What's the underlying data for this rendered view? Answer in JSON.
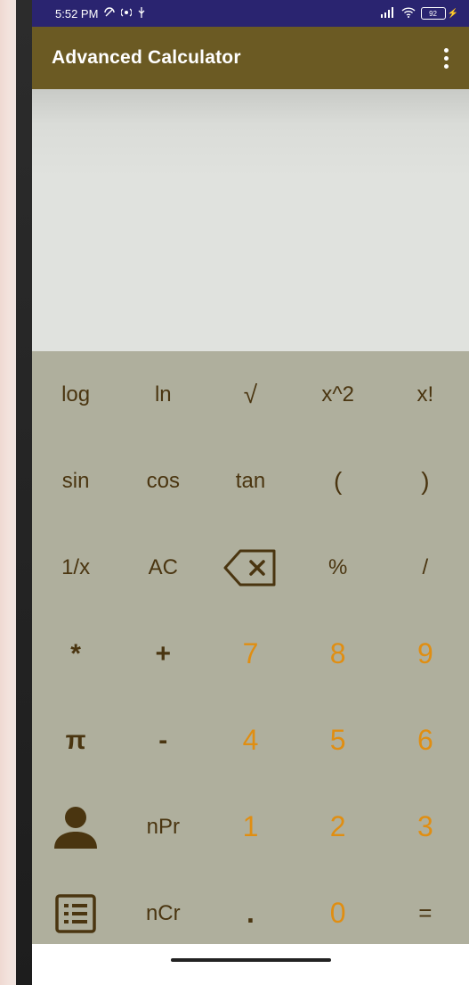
{
  "status": {
    "time": "5:52 PM",
    "left_icons": [
      "do-not-disturb-icon",
      "hotspot-icon",
      "usb-icon"
    ],
    "right_icons": [
      "signal-icon",
      "wifi-icon",
      "battery-icon"
    ],
    "battery": "92"
  },
  "appbar": {
    "title": "Advanced Calculator",
    "menu_icon": "more-vert-icon"
  },
  "colors": {
    "status_bar": "#2a2470",
    "app_bar": "#6b5a23",
    "keypad_bg": "#afaf9d",
    "display_bg": "#e0e2de",
    "digit_color": "#e08e12",
    "function_color": "#4a3510"
  },
  "keys": {
    "r1": [
      "log",
      "ln",
      "√",
      "x^2",
      "x!"
    ],
    "r2": [
      "sin",
      "cos",
      "tan",
      "(",
      ")"
    ],
    "r3": [
      "1/x",
      "AC",
      "backspace",
      "%",
      "/"
    ],
    "r4": [
      "*",
      "+",
      "7",
      "8",
      "9"
    ],
    "r5": [
      "π",
      "-",
      "4",
      "5",
      "6"
    ],
    "r6": [
      "person",
      "nPr",
      "1",
      "2",
      "3"
    ],
    "r7": [
      "list",
      "nCr",
      ".",
      "0",
      "="
    ]
  }
}
